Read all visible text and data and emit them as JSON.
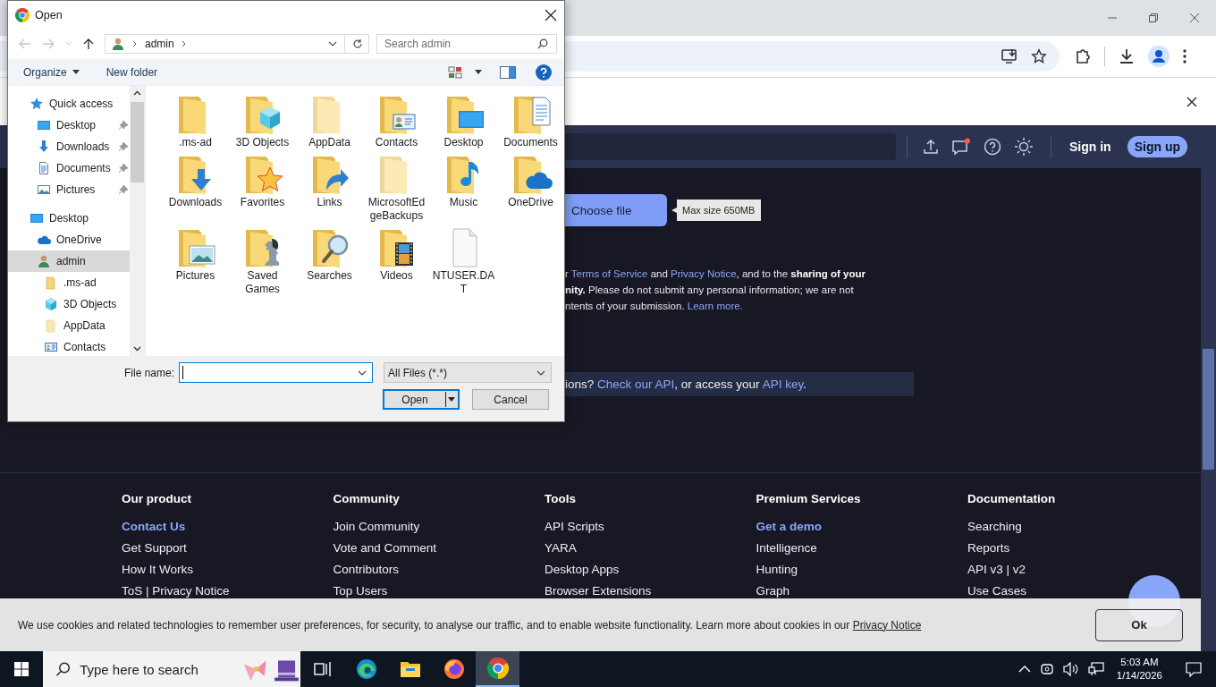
{
  "dialog": {
    "title": "Open",
    "path": [
      "admin"
    ],
    "search": {
      "placeholder": "Search admin"
    },
    "toolbar": {
      "organize": "Organize",
      "new_folder": "New folder"
    },
    "tree": [
      {
        "label": "Quick access",
        "kind": "star",
        "selected": false,
        "children": [
          {
            "label": "Desktop",
            "kind": "desktop",
            "selected": false,
            "pinned": true
          },
          {
            "label": "Downloads",
            "kind": "downloads",
            "selected": false,
            "pinned": true
          },
          {
            "label": "Documents",
            "kind": "documents",
            "selected": false,
            "pinned": true
          },
          {
            "label": "Pictures",
            "kind": "pictures",
            "selected": false,
            "pinned": true
          }
        ]
      },
      {
        "label": "Desktop",
        "kind": "desktop",
        "selected": false,
        "children": [
          {
            "label": "OneDrive",
            "kind": "onedrive",
            "selected": false
          },
          {
            "label": "admin",
            "kind": "user",
            "selected": true,
            "children": [
              {
                "label": ".ms-ad",
                "kind": "folder",
                "selected": false,
                "hidden": false
              },
              {
                "label": "3D Objects",
                "kind": "cube",
                "selected": false,
                "hidden": false
              },
              {
                "label": "AppData",
                "kind": "folder",
                "selected": false,
                "hidden": true
              },
              {
                "label": "Contacts",
                "kind": "contacts",
                "selected": false,
                "hidden": false
              }
            ]
          }
        ]
      }
    ],
    "items": [
      {
        "name": ".ms-ad",
        "kind": "plain",
        "hidden": false
      },
      {
        "name": "3D Objects",
        "kind": "cube",
        "hidden": false
      },
      {
        "name": "AppData",
        "kind": "plain",
        "hidden": true
      },
      {
        "name": "Contacts",
        "kind": "contacts",
        "hidden": false
      },
      {
        "name": "Desktop",
        "kind": "desktop",
        "hidden": false
      },
      {
        "name": "Documents",
        "kind": "documents",
        "hidden": false
      },
      {
        "name": "Downloads",
        "kind": "downloads",
        "hidden": false
      },
      {
        "name": "Favorites",
        "kind": "favorites",
        "hidden": false
      },
      {
        "name": "Links",
        "kind": "links",
        "hidden": false
      },
      {
        "name": "MicrosoftEdgeBackups",
        "kind": "plain",
        "hidden": true
      },
      {
        "name": "Music",
        "kind": "music",
        "hidden": false
      },
      {
        "name": "OneDrive",
        "kind": "onedrive",
        "hidden": false
      },
      {
        "name": "Pictures",
        "kind": "pictures",
        "hidden": false
      },
      {
        "name": "Saved Games",
        "kind": "games",
        "hidden": false
      },
      {
        "name": "Searches",
        "kind": "searches",
        "hidden": false
      },
      {
        "name": "Videos",
        "kind": "videos",
        "hidden": false
      },
      {
        "name": "NTUSER.DAT",
        "kind": "file",
        "hidden": false
      }
    ],
    "file_name_label": "File name:",
    "file_type": "All Files (*.*)",
    "open_button": "Open",
    "cancel_button": "Cancel"
  },
  "page": {
    "header": {
      "sign_in": "Sign in",
      "sign_up": "Sign up",
      "new_messages": true
    },
    "upload": {
      "button": "Choose file",
      "tooltip": "Max size 650MB"
    },
    "consent": [
      [
        {
          "t": "r ",
          "kind": "text"
        },
        {
          "t": "Terms of Service",
          "kind": "link"
        },
        {
          "t": " and ",
          "kind": "text"
        },
        {
          "t": "Privacy Notice",
          "kind": "link"
        },
        {
          "t": ", and to the ",
          "kind": "text"
        },
        {
          "t": "sharing of your",
          "kind": "bold"
        }
      ],
      [
        {
          "t": "nity.",
          "kind": "bold"
        },
        {
          "t": " Please do not submit any personal information; we are not",
          "kind": "text"
        }
      ],
      [
        {
          "t": "ntents of your submission. ",
          "kind": "text"
        },
        {
          "t": "Learn more.",
          "kind": "link"
        }
      ]
    ],
    "api_bar": [
      {
        "t": "ions? ",
        "kind": "text"
      },
      {
        "t": "Check our API",
        "kind": "link"
      },
      {
        "t": ", or access your ",
        "kind": "text"
      },
      {
        "t": "API key",
        "kind": "link"
      },
      {
        "t": ".",
        "kind": "text"
      }
    ],
    "footer": [
      {
        "heading": "Our product",
        "links": [
          {
            "label": "Contact Us",
            "highlighted": true
          },
          {
            "label": "Get Support",
            "highlighted": false
          },
          {
            "label": "How It Works",
            "highlighted": false
          },
          {
            "label": "ToS | Privacy Notice",
            "highlighted": false
          }
        ]
      },
      {
        "heading": "Community",
        "links": [
          {
            "label": "Join Community",
            "highlighted": false
          },
          {
            "label": "Vote and Comment",
            "highlighted": false
          },
          {
            "label": "Contributors",
            "highlighted": false
          },
          {
            "label": "Top Users",
            "highlighted": false
          }
        ]
      },
      {
        "heading": "Tools",
        "links": [
          {
            "label": "API Scripts",
            "highlighted": false
          },
          {
            "label": "YARA",
            "highlighted": false
          },
          {
            "label": "Desktop Apps",
            "highlighted": false
          },
          {
            "label": "Browser Extensions",
            "highlighted": false
          }
        ]
      },
      {
        "heading": "Premium Services",
        "links": [
          {
            "label": "Get a demo",
            "highlighted": true
          },
          {
            "label": "Intelligence",
            "highlighted": false
          },
          {
            "label": "Hunting",
            "highlighted": false
          },
          {
            "label": "Graph",
            "highlighted": false
          }
        ]
      },
      {
        "heading": "Documentation",
        "links": [
          {
            "label": "Searching",
            "highlighted": false
          },
          {
            "label": "Reports",
            "highlighted": false
          },
          {
            "label": "API v3 | v2",
            "highlighted": false
          },
          {
            "label": "Use Cases",
            "highlighted": false
          }
        ]
      }
    ],
    "cookie_banner": {
      "text": "We use cookies and related technologies to remember user preferences, for security, to analyse our traffic, and to enable website functionality. Learn more about cookies in our",
      "link": "Privacy Notice",
      "button": "Ok"
    }
  },
  "taskbar": {
    "search": {
      "placeholder": "Type here to search"
    },
    "apps": [
      {
        "kind": "task-view",
        "active": false
      },
      {
        "kind": "edge",
        "active": false
      },
      {
        "kind": "explorer",
        "active": false
      },
      {
        "kind": "firefox",
        "active": false
      },
      {
        "kind": "chrome",
        "active": true
      }
    ],
    "time": "5:03 AM",
    "date": "1/14/2026"
  }
}
